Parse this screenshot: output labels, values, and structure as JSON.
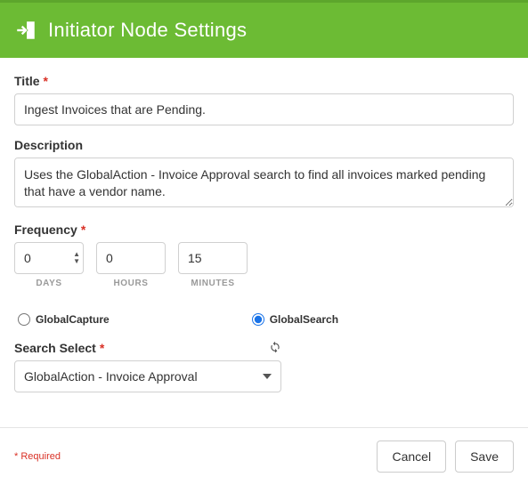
{
  "header": {
    "title": "Initiator Node Settings"
  },
  "fields": {
    "title": {
      "label": "Title",
      "required_mark": "*",
      "value": "Ingest Invoices that are Pending."
    },
    "description": {
      "label": "Description",
      "value": "Uses the GlobalAction - Invoice Approval search to find all invoices marked pending that have a vendor name."
    },
    "frequency": {
      "label": "Frequency",
      "required_mark": "*",
      "days": {
        "value": "0",
        "unit": "DAYS"
      },
      "hours": {
        "value": "0",
        "unit": "HOURS"
      },
      "minutes": {
        "value": "15",
        "unit": "MINUTES"
      }
    },
    "source": {
      "option_capture": "GlobalCapture",
      "option_search": "GlobalSearch",
      "selected": "GlobalSearch"
    },
    "search_select": {
      "label": "Search Select",
      "required_mark": "*",
      "value": "GlobalAction - Invoice Approval"
    }
  },
  "footer": {
    "required_note": "* Required",
    "cancel": "Cancel",
    "save": "Save"
  }
}
